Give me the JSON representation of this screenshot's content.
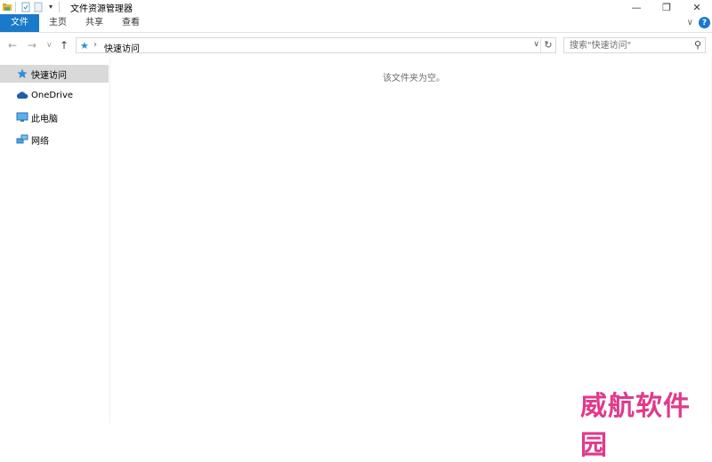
{
  "window": {
    "title": "文件资源管理器",
    "minimize_glyph": "—",
    "maximize_glyph": "❐",
    "close_glyph": "✕"
  },
  "ribbon": {
    "tabs": [
      "文件",
      "主页",
      "共享",
      "查看"
    ],
    "collapse_glyph": "∨",
    "help_glyph": "?"
  },
  "navigation": {
    "back_glyph": "←",
    "forward_glyph": "→",
    "recent_glyph": "∨",
    "up_glyph": "↑",
    "breadcrumb_separator": "›",
    "address": "快速访问",
    "address_dropdown_glyph": "∨",
    "refresh_glyph": "↻"
  },
  "search": {
    "placeholder": "搜索\"快速访问\""
  },
  "sidebar": {
    "items": [
      {
        "label": "快速访问",
        "icon": "star-icon",
        "active": true
      },
      {
        "label": "OneDrive",
        "icon": "cloud-icon",
        "active": false
      },
      {
        "label": "此电脑",
        "icon": "computer-icon",
        "active": false
      },
      {
        "label": "网络",
        "icon": "network-icon",
        "active": false
      }
    ]
  },
  "main": {
    "empty_message": "该文件夹为空。"
  },
  "watermark": {
    "text": "威航软件园"
  },
  "colors": {
    "accent": "#1979ca",
    "selected_item": "#d9d9d9",
    "watermark": "#e03a8c"
  }
}
